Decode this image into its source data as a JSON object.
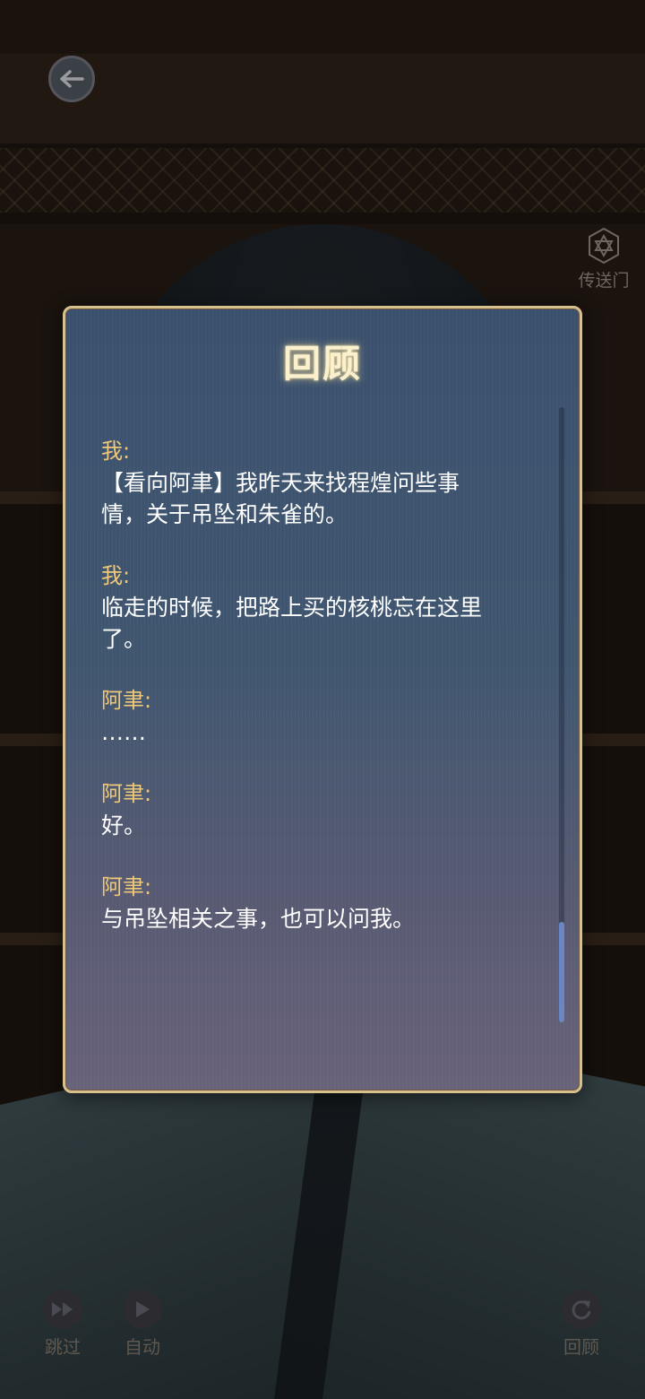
{
  "hud": {
    "portal_label": "传送门",
    "skip_label": "跳过",
    "auto_label": "自动",
    "review_label": "回顾"
  },
  "dialog": {
    "title": "回顾",
    "entries": [
      {
        "speaker": "我:",
        "text": [
          "【看向阿聿】我昨天来找程煌问些事",
          "情，关于吊坠和朱雀的。"
        ]
      },
      {
        "speaker": "我:",
        "text": [
          "临走的时候，把路上买的核桃忘在这里",
          "了。"
        ]
      },
      {
        "speaker": "阿聿:",
        "text": [
          "……"
        ]
      },
      {
        "speaker": "阿聿:",
        "text": [
          "好。"
        ]
      },
      {
        "speaker": "阿聿:",
        "text": [
          "与吊坠相关之事，也可以问我。"
        ]
      }
    ]
  },
  "colors": {
    "speaker": "#efc878",
    "dialog_border": "#d8bf8e",
    "scroll_thumb": "#6a86c4"
  },
  "icons": [
    "back-arrow-icon",
    "portal-icon",
    "fast-forward-icon",
    "play-icon",
    "replay-icon"
  ]
}
